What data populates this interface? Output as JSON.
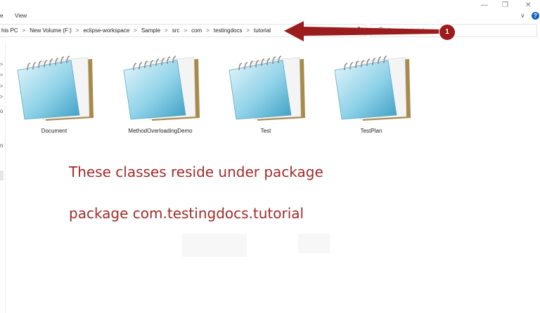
{
  "ribbon": {
    "tab_partial": "e",
    "view_label": "View"
  },
  "window_controls": {
    "minimize": "—",
    "restore": "❐",
    "close": "✕"
  },
  "ribbon_toggle": "∨",
  "help_label": "?",
  "address_bar": {
    "crumbs": [
      "his PC",
      "New Volume (F:)",
      "eclipse-workspace",
      "Sample",
      "src",
      "com",
      "testingdocs",
      "tutorial"
    ],
    "separator": ">",
    "dropdown": "∨",
    "refresh": "↻"
  },
  "search": {
    "placeholder": "Search tutorial"
  },
  "nav_pane": {
    "partial_labels": [
      "o",
      "n"
    ],
    "expand_glyph": ">"
  },
  "files": [
    {
      "name": "Document",
      "icon": "notepad-file-icon"
    },
    {
      "name": "MethodOverloadingDemo",
      "icon": "notepad-file-icon"
    },
    {
      "name": "Test",
      "icon": "notepad-file-icon"
    },
    {
      "name": "TestPlan",
      "icon": "notepad-file-icon"
    }
  ],
  "callout": {
    "number": "1",
    "arrow_color": "#9b1c1c"
  },
  "annotation": {
    "line1": "These classes reside under package",
    "line2": "package com.testingdocs.tutorial",
    "color": "#a12b2b"
  }
}
